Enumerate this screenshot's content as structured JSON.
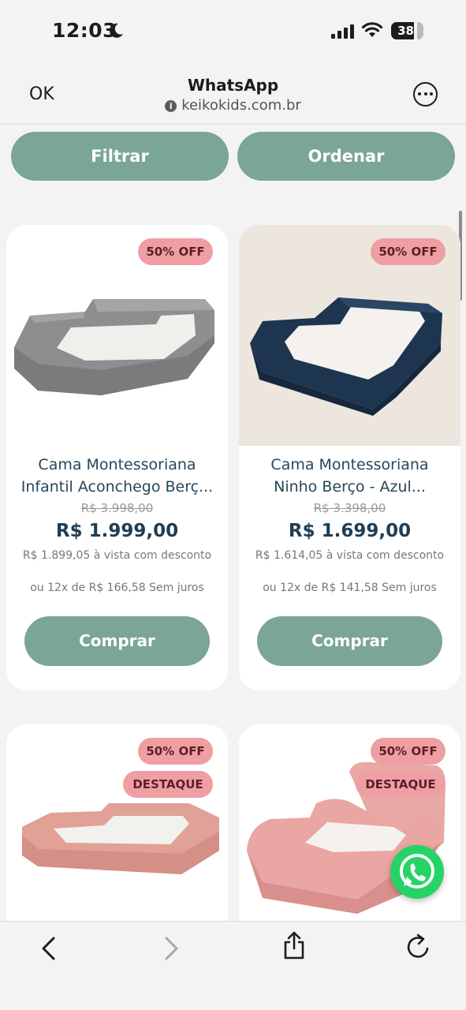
{
  "status_bar": {
    "time": "12:03",
    "battery": "38",
    "icons": [
      "moon-icon",
      "signal-icon",
      "wifi-icon",
      "battery-icon"
    ]
  },
  "browser": {
    "ok_label": "OK",
    "title": "WhatsApp",
    "url": "keikokids.com.br",
    "more_icon": "ellipsis-circle-icon"
  },
  "actions": {
    "filter_label": "Filtrar",
    "order_label": "Ordenar"
  },
  "products": [
    {
      "badge": "50% OFF",
      "title": "Cama Montessoriana Infantil Aconchego Berç...",
      "old_price": "R$ 3.998,00",
      "price": "R$ 1.999,00",
      "cash_price": "R$ 1.899,05 à vista com desconto",
      "installments": "ou 12x de R$ 166,58 Sem juros",
      "buy_label": "Comprar",
      "color": "#9c9c9c"
    },
    {
      "badge": "50% OFF",
      "title": "Cama Montessoriana Ninho Berço - Azul...",
      "old_price": "R$ 3.398,00",
      "price": "R$ 1.699,00",
      "cash_price": "R$ 1.614,05 à vista com desconto",
      "installments": "ou 12x de R$ 141,58 Sem juros",
      "buy_label": "Comprar",
      "color": "#1f3650"
    },
    {
      "badge": "50% OFF",
      "badge2": "DESTAQUE",
      "color": "#e3a59c"
    },
    {
      "badge": "50% OFF",
      "badge2": "DESTAQUE",
      "color": "#e7a5a2"
    }
  ],
  "toolbar": {
    "icons": [
      "back-icon",
      "forward-icon",
      "share-icon",
      "reload-icon"
    ]
  },
  "whatsapp_button": "whatsapp-icon"
}
